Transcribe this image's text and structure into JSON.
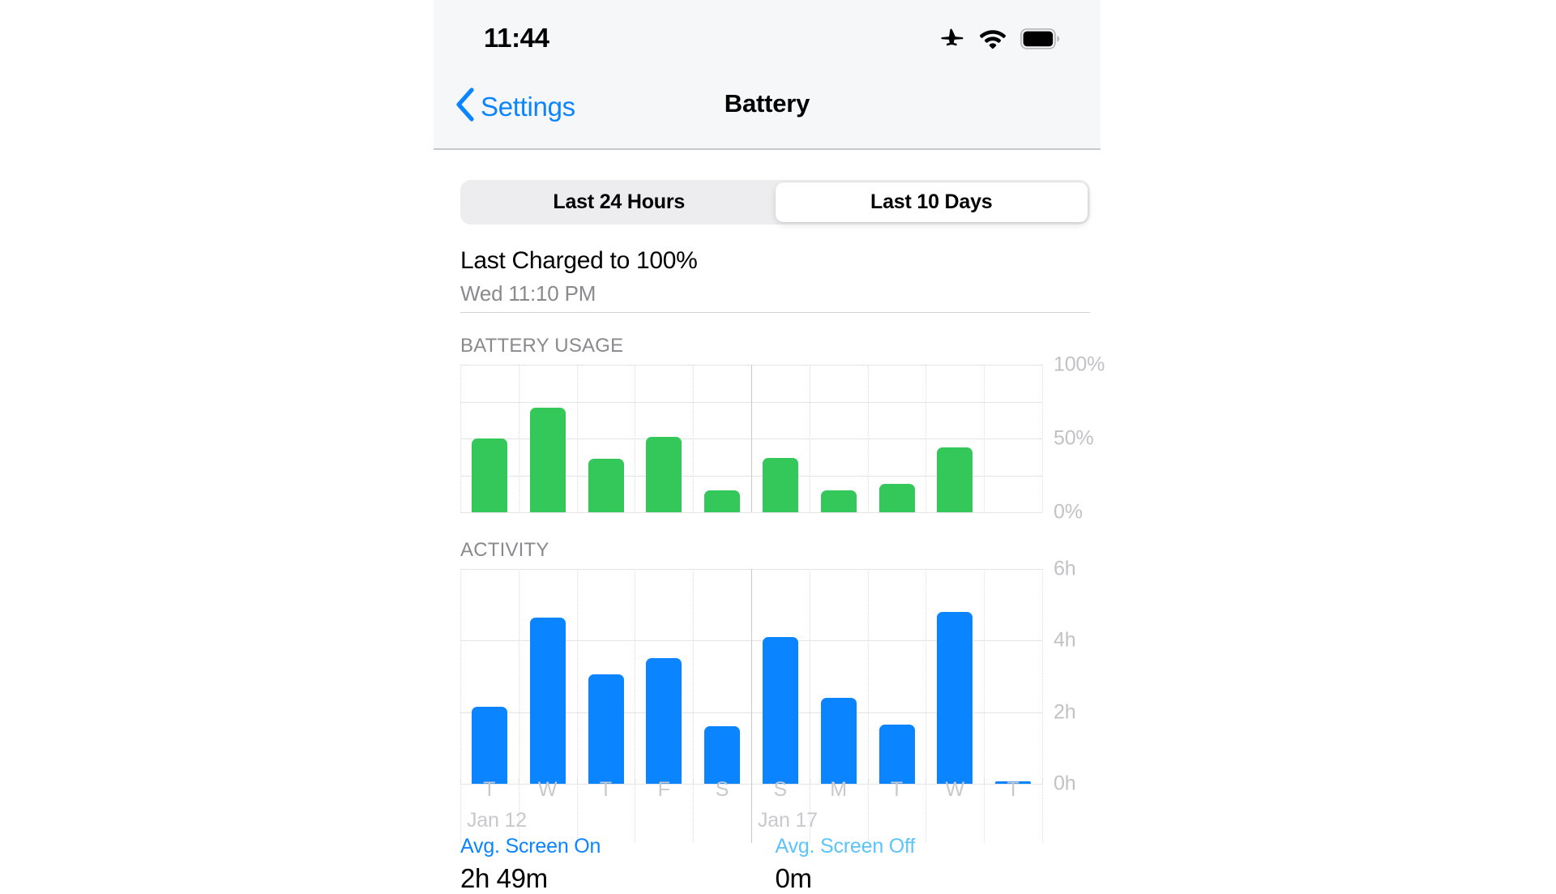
{
  "status_bar": {
    "time": "11:44",
    "icons": [
      "airplane-mode-icon",
      "wifi-icon",
      "battery-full-icon"
    ]
  },
  "nav_bar": {
    "back_label": "Settings",
    "back_icon": "chevron-left-icon",
    "title": "Battery"
  },
  "segmented_control": {
    "options": [
      {
        "label": "Last 24 Hours",
        "selected": false
      },
      {
        "label": "Last 10 Days",
        "selected": true
      }
    ]
  },
  "last_charged": {
    "title": "Last Charged to 100%",
    "subtitle": "Wed 11:10 PM"
  },
  "stats": [
    {
      "label": "Avg. Screen On",
      "value": "2h 49m",
      "color": "#0a84ff"
    },
    {
      "label": "Avg. Screen Off",
      "value": "0m",
      "color": "#5cc3fb"
    }
  ],
  "axis": {
    "days": [
      "T",
      "W",
      "T",
      "F",
      "S",
      "S",
      "M",
      "T",
      "W",
      "T"
    ],
    "date_marks": [
      {
        "label": "Jan 12",
        "index": 0
      },
      {
        "label": "Jan 17",
        "index": 5
      }
    ]
  },
  "chart_data": [
    {
      "type": "bar",
      "title": "BATTERY USAGE",
      "xlabel": "",
      "ylabel": "",
      "ylim": [
        0,
        100
      ],
      "yticks": [
        0,
        25,
        50,
        75,
        100
      ],
      "ytick_labels": [
        "0%",
        "",
        "50%",
        "",
        "100%"
      ],
      "grid": true,
      "legend": "none",
      "bar_color": "#34c759",
      "categories": [
        "T",
        "W",
        "T",
        "F",
        "S",
        "S",
        "M",
        "T",
        "W",
        "T"
      ],
      "values": [
        50,
        71,
        36,
        51,
        15,
        37,
        15,
        19,
        44,
        0
      ]
    },
    {
      "type": "bar",
      "title": "ACTIVITY",
      "xlabel": "",
      "ylabel": "",
      "ylim": [
        0,
        6
      ],
      "yticks": [
        0,
        2,
        4,
        6
      ],
      "ytick_labels": [
        "0h",
        "2h",
        "4h",
        "6h"
      ],
      "grid": true,
      "legend": "none",
      "bar_color": "#0a84ff",
      "categories": [
        "T",
        "W",
        "T",
        "F",
        "S",
        "S",
        "M",
        "T",
        "W",
        "T"
      ],
      "values": [
        2.15,
        4.65,
        3.05,
        3.5,
        1.6,
        4.1,
        2.4,
        1.65,
        4.8,
        0.04
      ]
    }
  ]
}
